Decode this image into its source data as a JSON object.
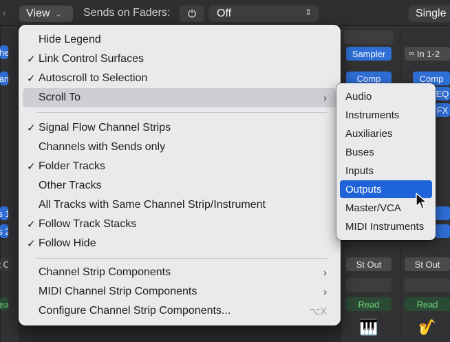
{
  "topbar": {
    "view_label": "View",
    "sends_label": "Sends on Faders:",
    "power_glyph": "⏻",
    "sends_value": "Off",
    "layout_label": "Single"
  },
  "mixer": {
    "chips": {
      "left_1": "he",
      "left_2": "an",
      "left_3": "s 1",
      "left_4": "s 2",
      "left_5": "t O",
      "left_6": "ea",
      "sampler": "Sampler",
      "input_right": "In 1-2",
      "comp_1": "Comp",
      "comp_2": "Comp",
      "eq": "EQ",
      "fx": "FX",
      "st_out_1": "St Out",
      "st_out_2": "St Out",
      "read_1": "Read",
      "read_2": "Read"
    },
    "icons": {
      "piano": "grand-piano-icon",
      "sax": "saxophone-icon",
      "keyboard": "keyboard-icon",
      "link": "stereo-link-icon"
    }
  },
  "menu": {
    "items": [
      {
        "label": "Hide Legend",
        "checked": false,
        "submenu": false
      },
      {
        "label": "Link Control Surfaces",
        "checked": true,
        "submenu": false
      },
      {
        "label": "Autoscroll to Selection",
        "checked": true,
        "submenu": false
      },
      {
        "label": "Scroll To",
        "checked": false,
        "submenu": true
      },
      {
        "label": "Signal Flow Channel Strips",
        "checked": true,
        "submenu": false
      },
      {
        "label": "Channels with Sends only",
        "checked": false,
        "submenu": false
      },
      {
        "label": "Folder Tracks",
        "checked": true,
        "submenu": false
      },
      {
        "label": "Other Tracks",
        "checked": false,
        "submenu": false
      },
      {
        "label": "All Tracks with Same Channel Strip/Instrument",
        "checked": false,
        "submenu": false
      },
      {
        "label": "Follow Track Stacks",
        "checked": true,
        "submenu": false
      },
      {
        "label": "Follow Hide",
        "checked": true,
        "submenu": false
      },
      {
        "label": "Channel Strip Components",
        "checked": false,
        "submenu": true
      },
      {
        "label": "MIDI Channel Strip Components",
        "checked": false,
        "submenu": true
      },
      {
        "label": "Configure Channel Strip Components...",
        "checked": false,
        "submenu": false,
        "shortcut": "⌥X"
      }
    ],
    "check_glyph": "✓",
    "arrow_glyph": "›"
  },
  "submenu": {
    "items": [
      "Audio",
      "Instruments",
      "Auxiliaries",
      "Buses",
      "Inputs",
      "Outputs",
      "Master/VCA",
      "MIDI Instruments"
    ],
    "selected": "Outputs"
  },
  "colors": {
    "menu_bg": "#eaeaec",
    "selection": "#1f63d9",
    "mixer_blue": "#2f6fd6"
  }
}
